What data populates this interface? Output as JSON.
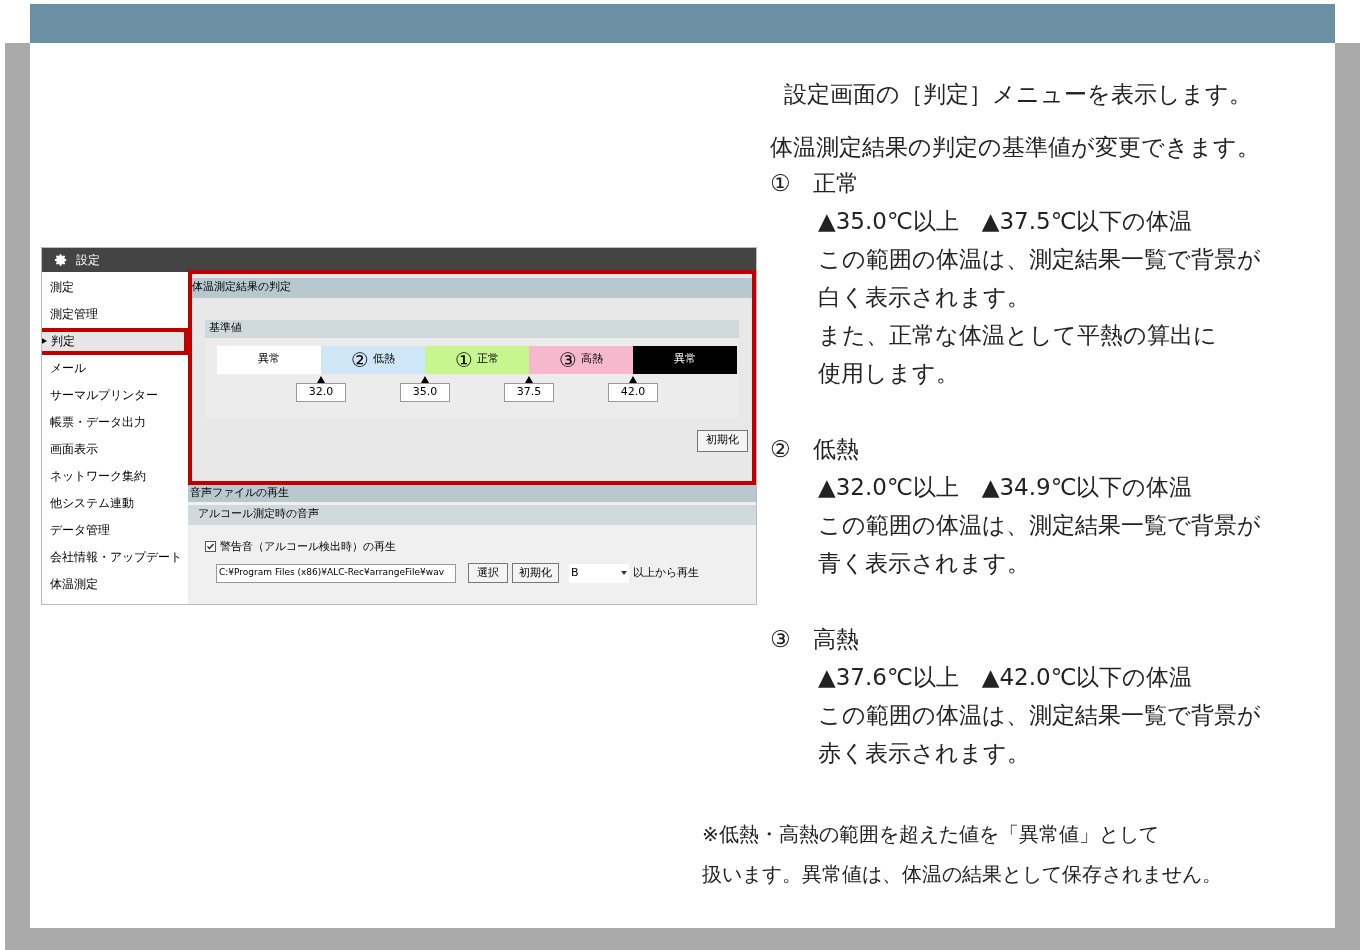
{
  "settings_window": {
    "title": "設定",
    "sidebar": [
      {
        "label": "測定",
        "selected": false
      },
      {
        "label": "測定管理",
        "selected": false
      },
      {
        "label": "判定",
        "selected": true
      },
      {
        "label": "メール",
        "selected": false
      },
      {
        "label": "サーマルプリンター",
        "selected": false
      },
      {
        "label": "帳票・データ出力",
        "selected": false
      },
      {
        "label": "画面表示",
        "selected": false
      },
      {
        "label": "ネットワーク集約",
        "selected": false
      },
      {
        "label": "他システム連動",
        "selected": false
      },
      {
        "label": "データ管理",
        "selected": false
      },
      {
        "label": "会社情報・アップデート",
        "selected": false
      },
      {
        "label": "体温測定",
        "selected": false
      }
    ],
    "judge_section": {
      "title": "体温測定結果の判定",
      "subtitle": "基準値",
      "bands": [
        {
          "label": "異常",
          "color": "#ffffff"
        },
        {
          "marker": "②",
          "label": "低熱",
          "color": "#cfe6f7"
        },
        {
          "marker": "①",
          "label": "正常",
          "color": "#c8f58e"
        },
        {
          "marker": "③",
          "label": "高熱",
          "color": "#f6b8cc"
        },
        {
          "label": "異常",
          "color": "#000000"
        }
      ],
      "thresholds": [
        "32.0",
        "35.0",
        "37.5",
        "42.0"
      ],
      "reset_button": "初期化"
    },
    "sound_section": {
      "title": "音声ファイルの再生",
      "subtitle": "アルコール測定時の音声",
      "checkbox": {
        "label": "警告音（アルコール検出時）の再生",
        "checked": true
      },
      "path": "C:¥Program Files (x86)¥ALC-Rec¥arrangeFile¥wav",
      "buttons": [
        "選択",
        "初期化"
      ],
      "select": "B",
      "suffix": "以上から再生"
    }
  },
  "description": {
    "intro": "設定画面の［判定］メニューを表示します。",
    "lead": "体温測定結果の判定の基準値が変更できます。",
    "items": [
      {
        "number": "①",
        "name": "正常",
        "lines": [
          "▲35.0℃以上　▲37.5℃以下の体温",
          "この範囲の体温は、測定結果一覧で背景が",
          "白く表示されます。",
          "また、正常な体温として平熱の算出に",
          "使用します。"
        ]
      },
      {
        "number": "②",
        "name": "低熱",
        "lines": [
          "▲32.0℃以上　▲34.9℃以下の体温",
          "この範囲の体温は、測定結果一覧で背景が",
          "青く表示されます。"
        ]
      },
      {
        "number": "③",
        "name": "高熱",
        "lines": [
          "▲37.6℃以上　▲42.0℃以下の体温",
          "この範囲の体温は、測定結果一覧で背景が",
          "赤く表示されます。"
        ]
      }
    ],
    "note": [
      "※低熱・高熱の範囲を超えた値を「異常値」として",
      "扱います。異常値は、体温の結果として保存されません。"
    ]
  }
}
